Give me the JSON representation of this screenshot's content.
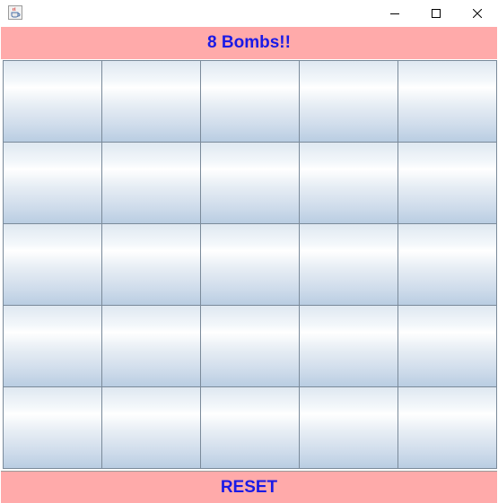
{
  "window": {
    "icon": "java-cup-icon",
    "controls": [
      "minimize-icon",
      "maximize-icon",
      "close-icon"
    ]
  },
  "game": {
    "status": "8 Bombs!!",
    "reset_label": "RESET",
    "rows": 5,
    "cols": 5,
    "cells": [
      [
        "",
        "",
        "",
        "",
        ""
      ],
      [
        "",
        "",
        "",
        "",
        ""
      ],
      [
        "",
        "",
        "",
        "",
        ""
      ],
      [
        "",
        "",
        "",
        "",
        ""
      ],
      [
        "",
        "",
        "",
        "",
        ""
      ]
    ]
  },
  "colors": {
    "banner_bg": "#ffaaaa",
    "banner_text": "#1a1ae6",
    "cell_border": "#7a8a9a"
  }
}
